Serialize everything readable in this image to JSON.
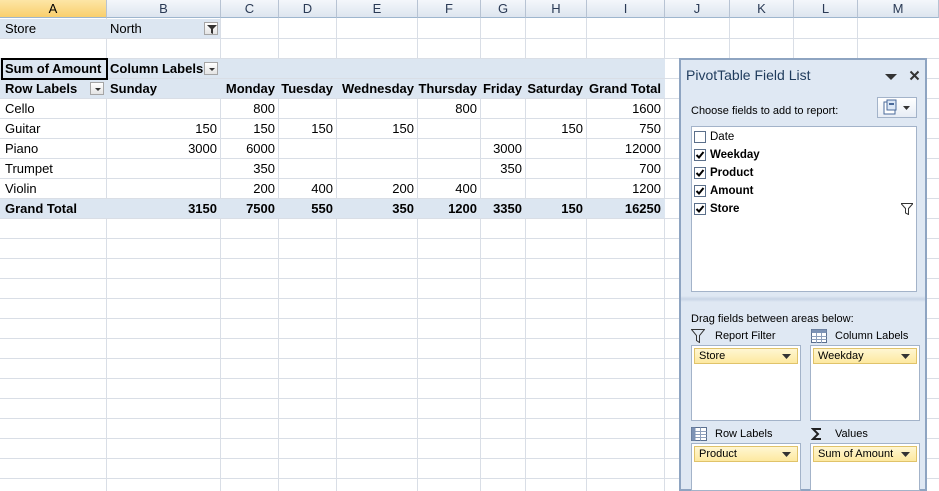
{
  "columns": [
    "A",
    "B",
    "C",
    "D",
    "E",
    "F",
    "G",
    "H",
    "I",
    "J",
    "K",
    "L",
    "M"
  ],
  "active_column": "A",
  "filter": {
    "label": "Store",
    "value": "North"
  },
  "pivot": {
    "corner": "Sum of Amount",
    "column_labels": "Column Labels",
    "row_labels": "Row Labels",
    "headers": [
      "Sunday",
      "Monday",
      "Tuesday",
      "Wednesday",
      "Thursday",
      "Friday",
      "Saturday",
      "Grand Total"
    ],
    "rows": [
      {
        "label": "Cello",
        "values": [
          "",
          "800",
          "",
          "",
          "800",
          "",
          "",
          "1600"
        ]
      },
      {
        "label": "Guitar",
        "values": [
          "150",
          "150",
          "150",
          "150",
          "",
          "",
          "150",
          "750"
        ]
      },
      {
        "label": "Piano",
        "values": [
          "3000",
          "6000",
          "",
          "",
          "",
          "3000",
          "",
          "12000"
        ]
      },
      {
        "label": "Trumpet",
        "values": [
          "",
          "350",
          "",
          "",
          "",
          "350",
          "",
          "700"
        ]
      },
      {
        "label": "Violin",
        "values": [
          "",
          "200",
          "400",
          "200",
          "400",
          "",
          "",
          "1200"
        ]
      }
    ],
    "total": {
      "label": "Grand Total",
      "values": [
        "3150",
        "7500",
        "550",
        "350",
        "1200",
        "3350",
        "150",
        "16250"
      ]
    }
  },
  "panel": {
    "title": "PivotTable Field List",
    "choose_text": "Choose fields to add to report:",
    "fields": [
      {
        "name": "Date",
        "checked": false
      },
      {
        "name": "Weekday",
        "checked": true
      },
      {
        "name": "Product",
        "checked": true
      },
      {
        "name": "Amount",
        "checked": true
      },
      {
        "name": "Store",
        "checked": true
      }
    ],
    "drag_text": "Drag fields between areas below:",
    "areas": {
      "report_filter": {
        "label": "Report Filter",
        "items": [
          "Store"
        ]
      },
      "column_labels": {
        "label": "Column Labels",
        "items": [
          "Weekday"
        ]
      },
      "row_labels": {
        "label": "Row Labels",
        "items": [
          "Product"
        ]
      },
      "values": {
        "label": "Values",
        "items": [
          "Sum of Amount"
        ]
      }
    }
  },
  "icons": {
    "filter": "filter-icon",
    "dropdown": "chevron-down-icon",
    "close": "close-icon",
    "layout": "field-layout-icon",
    "values": "sigma-icon"
  },
  "colors": {
    "band": "#dce6f1",
    "panel": "#dfe8f3",
    "chip": "#fde9a0"
  }
}
